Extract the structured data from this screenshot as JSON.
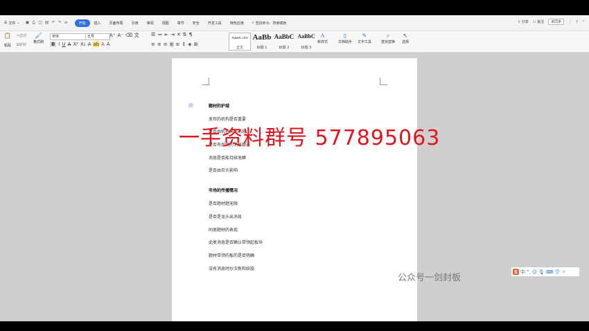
{
  "menu": {
    "file_label": "文件",
    "tabs": [
      "开始",
      "插入",
      "页面布局",
      "引用",
      "审阅",
      "视图",
      "章节",
      "安全",
      "开发工具",
      "特色应用"
    ],
    "active_tab": "开始",
    "search_label": "查找命令、搜索模板"
  },
  "right_controls": {
    "share": "分享",
    "comment": "批注",
    "status": "未同步"
  },
  "ribbon": {
    "paste": "粘贴",
    "cut": "剪切",
    "copy": "复制",
    "format_painter": "格式刷",
    "font_name": "宋体",
    "font_size": "五号",
    "styles": [
      {
        "preview": "AaBbCcDd",
        "name": "正文"
      },
      {
        "preview": "AaBb",
        "name": "标题 1"
      },
      {
        "preview": "AaBbC",
        "name": "标题 2"
      },
      {
        "preview": "AaBbC",
        "name": "标题 3"
      }
    ],
    "new_style": "新样式",
    "doc_helper": "文档助手",
    "text_tools": "文字工具",
    "find_replace": "查找替换",
    "select": "选择"
  },
  "document": {
    "section1": {
      "heading": "题材的护城",
      "items": [
        "发布的机构是否重要",
        "是否由机构来出消息",
        "是否有后续的消息跟进",
        "消息是否能持续发酵",
        "是否由巨头影响"
      ]
    },
    "section2": {
      "heading": "市场的传播情况",
      "items": [
        "是否题材题无限",
        "是否是龙头出消息",
        "同类题材的表现",
        "此类消息是否确认带领起板块",
        "题材带领的板的是否明确",
        "没有消息时炒次新和妖股"
      ]
    }
  },
  "overlay": {
    "watermark": "一手资料群号  577895063",
    "wechat_mark": "公众号一剑封板"
  },
  "ime_toolbar": {
    "logo": "S",
    "mode": "中"
  }
}
